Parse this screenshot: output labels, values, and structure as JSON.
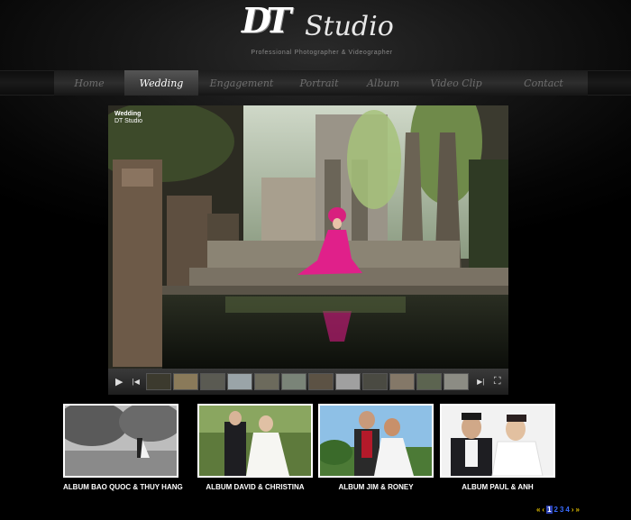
{
  "brand": {
    "logo_mark": "DT",
    "logo_word": "Studio",
    "tagline": "Professional Photographer & Videographer"
  },
  "nav": {
    "items": [
      {
        "label": "Home",
        "active": false
      },
      {
        "label": "Wedding",
        "active": true
      },
      {
        "label": "Engagement",
        "active": false
      },
      {
        "label": "Portrait",
        "active": false
      },
      {
        "label": "Album",
        "active": false
      },
      {
        "label": "Video Clip",
        "active": false
      },
      {
        "label": "Contact",
        "active": false
      }
    ]
  },
  "slideshow": {
    "caption_title": "Wedding",
    "caption_subtitle": "DT Studio",
    "controls": {
      "play": "▶",
      "prev": "|◀",
      "next": "▶|",
      "fullscreen": "⛶"
    }
  },
  "albums": [
    {
      "label": "ALBUM BAO QUOC & THUY HANG"
    },
    {
      "label": "ALBUM DAVID & CHRISTINA"
    },
    {
      "label": "ALBUM JIM & RONEY"
    },
    {
      "label": "ALBUM PAUL & ANH"
    }
  ],
  "pager": {
    "prev": "«",
    "prev_single": "‹",
    "pages": [
      "1",
      "2",
      "3",
      "4"
    ],
    "current": "1",
    "next_single": "›",
    "next": "»"
  },
  "colors": {
    "active_nav_bg": "#444444",
    "pager_arrow": "#e3c000",
    "pager_link": "#3a6cff",
    "dress_pink": "#e0208a"
  }
}
